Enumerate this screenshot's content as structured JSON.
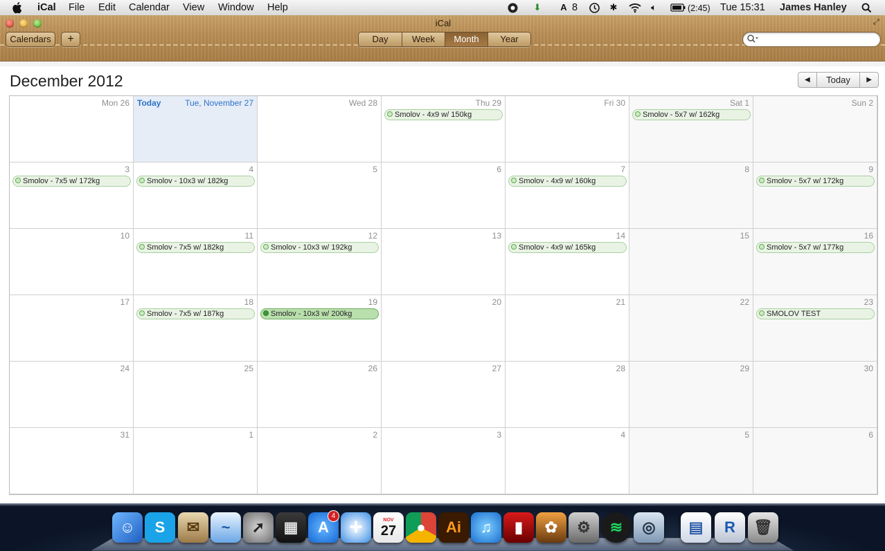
{
  "menubar": {
    "app_name": "iCal",
    "items": [
      "File",
      "Edit",
      "Calendar",
      "View",
      "Window",
      "Help"
    ],
    "status": {
      "notification_count": "8",
      "battery": "(2:45)",
      "clock": "Tue 15:31",
      "user": "James Hanley"
    }
  },
  "window": {
    "title": "iCal",
    "calendars_label": "Calendars",
    "add_label": "+",
    "views": [
      "Day",
      "Week",
      "Month",
      "Year"
    ],
    "active_view": "Month",
    "search_placeholder": ""
  },
  "calendar": {
    "month_title": "December 2012",
    "today_button": "Today",
    "prev_symbol": "◀",
    "next_symbol": "▶",
    "today_label": "Today",
    "weeks": [
      [
        {
          "label": "Mon 26"
        },
        {
          "label": "Tue, November 27",
          "today": true
        },
        {
          "label": "Wed 28"
        },
        {
          "label": "Thu 29",
          "event": "Smolov - 4x9 w/ 150kg"
        },
        {
          "label": "Fri 30"
        },
        {
          "label": "Sat 1",
          "event": "Smolov - 5x7 w/ 162kg"
        },
        {
          "label": "Sun 2"
        }
      ],
      [
        {
          "label": "3",
          "event": "Smolov - 7x5 w/ 172kg"
        },
        {
          "label": "4",
          "event": "Smolov - 10x3 w/ 182kg"
        },
        {
          "label": "5"
        },
        {
          "label": "6"
        },
        {
          "label": "7",
          "event": "Smolov - 4x9 w/ 160kg"
        },
        {
          "label": "8"
        },
        {
          "label": "9",
          "event": "Smolov - 5x7 w/ 172kg"
        }
      ],
      [
        {
          "label": "10"
        },
        {
          "label": "11",
          "event": "Smolov - 7x5 w/ 182kg"
        },
        {
          "label": "12",
          "event": "Smolov - 10x3 w/ 192kg"
        },
        {
          "label": "13"
        },
        {
          "label": "14",
          "event": "Smolov - 4x9 w/ 165kg"
        },
        {
          "label": "15"
        },
        {
          "label": "16",
          "event": "Smolov - 5x7 w/ 177kg"
        }
      ],
      [
        {
          "label": "17"
        },
        {
          "label": "18",
          "event": "Smolov - 7x5 w/ 187kg"
        },
        {
          "label": "19",
          "event": "Smolov - 10x3 w/ 200kg",
          "selected": true
        },
        {
          "label": "20"
        },
        {
          "label": "21"
        },
        {
          "label": "22"
        },
        {
          "label": "23",
          "event": "SMOLOV TEST"
        }
      ],
      [
        {
          "label": "24"
        },
        {
          "label": "25"
        },
        {
          "label": "26"
        },
        {
          "label": "27"
        },
        {
          "label": "28"
        },
        {
          "label": "29"
        },
        {
          "label": "30"
        }
      ],
      [
        {
          "label": "31"
        },
        {
          "label": "1"
        },
        {
          "label": "2"
        },
        {
          "label": "3"
        },
        {
          "label": "4"
        },
        {
          "label": "5"
        },
        {
          "label": "6"
        }
      ]
    ]
  },
  "dock": {
    "calendar_icon_month": "NOV",
    "calendar_icon_day": "27",
    "app_store_badge": "4",
    "icons": [
      "finder-icon",
      "skype-icon",
      "mail-icon",
      "openoffice-icon",
      "launchpad-icon",
      "photo-booth-icon",
      "app-store-icon",
      "safari-icon",
      "ical-icon",
      "chrome-icon",
      "illustrator-icon",
      "itunes-icon",
      "dvd-player-icon",
      "iphoto-icon",
      "system-preferences-icon",
      "spotify-icon",
      "preview-icon",
      "pdf-document-icon",
      "r-icon",
      "trash-icon"
    ]
  }
}
